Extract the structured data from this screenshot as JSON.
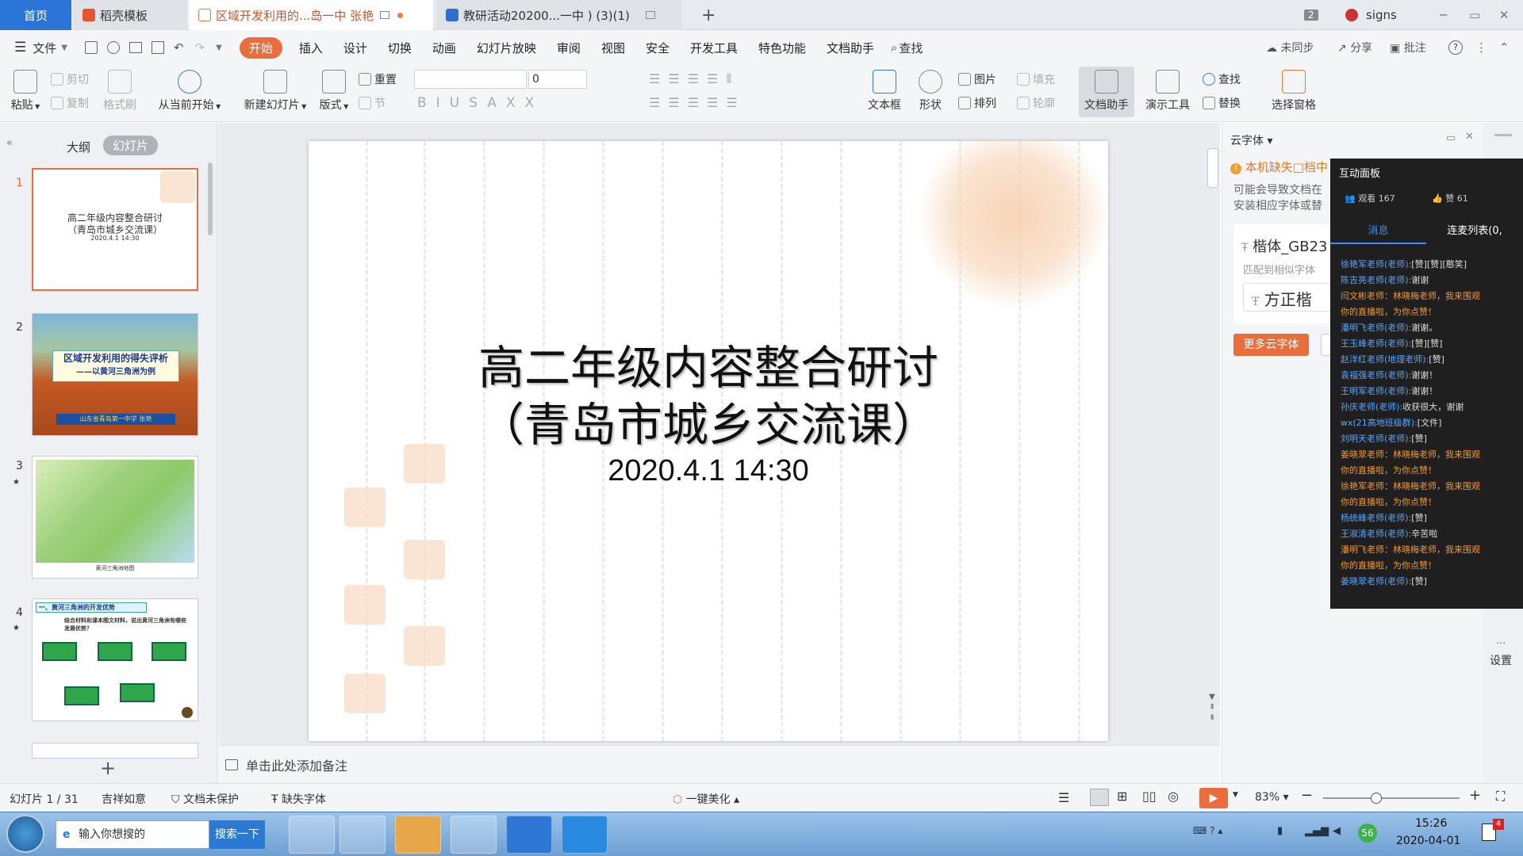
{
  "tabs": {
    "home": "首页",
    "templates": "稻壳模板",
    "doc1": "区域开发利用的...岛一中 张艳",
    "doc2": "教研活动20200...一中 ) (3)(1)",
    "add": "+",
    "badge": "2",
    "user": "signs"
  },
  "menu": {
    "file": "文件",
    "items": [
      "开始",
      "插入",
      "设计",
      "切换",
      "动画",
      "幻灯片放映",
      "审阅",
      "视图",
      "安全",
      "开发工具",
      "特色功能",
      "文档助手"
    ],
    "search": "查找",
    "sync": "未同步",
    "share": "分享",
    "annotate": "批注"
  },
  "ribbon": {
    "paste": "粘贴",
    "cut": "剪切",
    "copy": "复制",
    "format_painter": "格式刷",
    "from_current": "从当前开始",
    "new_slide": "新建幻灯片",
    "layout": "版式",
    "reset": "重置",
    "section": "节",
    "font_size": "0",
    "textbox": "文本框",
    "shape": "形状",
    "picture": "图片",
    "fill": "填充",
    "arrange": "排列",
    "outline": "轮廓",
    "doc_assistant": "文档助手",
    "present_tools": "演示工具",
    "find": "查找",
    "replace": "替换",
    "select_pane": "选择窗格"
  },
  "left_panel": {
    "outline_tab": "大纲",
    "slides_tab": "幻灯片",
    "thumbs": [
      {
        "num": "1",
        "line1": "高二年级内容整合研讨",
        "line2": "（青岛市城乡交流课）",
        "line3": "2020.4.1   14:30"
      },
      {
        "num": "2",
        "line1": "区域开发利用的得失评析",
        "line2": "——以黄河三角洲为例",
        "line3": "山东省青岛第一中学   张艳"
      },
      {
        "num": "3",
        "caption": "黄河三角洲地图"
      },
      {
        "num": "4",
        "heading": "一、黄河三角洲的开发优势",
        "sub": "结合材料和课本图文材料，说出黄河三角洲有哪些发展优势？"
      }
    ]
  },
  "slide": {
    "title_line1": "高二年级内容整合研讨",
    "title_line2": "（青岛市城乡交流课）",
    "date": "2020.4.1   14:30"
  },
  "notes": {
    "placeholder": "单击此处添加备注"
  },
  "right_panel": {
    "title": "云字体",
    "warning": "本机缺失□档中",
    "desc_line1": "可能会导致文档在",
    "desc_line2": "安装相应字体或替",
    "font_name": "楷体_GB23",
    "match_label": "匹配到相似字体",
    "font_sample": "方正楷",
    "more_btn": "更多云字体",
    "settings": "设置"
  },
  "live": {
    "title": "互动面板",
    "viewers": "观看 167",
    "likes": "赞 61",
    "tab_messages": "消息",
    "tab_mic": "连麦列表(0,",
    "messages": [
      {
        "user": "徐艳军老师(老师):",
        "text": "[赞][赞][憨笑]",
        "type": "u"
      },
      {
        "user": "陈吉亮老师(老师):",
        "text": "谢谢",
        "type": "u"
      },
      {
        "user": "",
        "text": "闫文彬老师：林晓梅老师，我来围观",
        "type": "o"
      },
      {
        "user": "",
        "text": "你的直播啦，为你点赞！",
        "type": "o"
      },
      {
        "user": "潘明飞老师(老师):",
        "text": "谢谢。",
        "type": "u"
      },
      {
        "user": "王玉峰老师(老师):",
        "text": "[赞][赞]",
        "type": "u"
      },
      {
        "user": "赵洋红老师(地理老师):",
        "text": "[赞]",
        "type": "u"
      },
      {
        "user": "袁福强老师(老师):",
        "text": "谢谢！",
        "type": "u"
      },
      {
        "user": "王明军老师(老师):",
        "text": "谢谢！",
        "type": "u"
      },
      {
        "user": "孙庆老师(老师):",
        "text": "收获很大，谢谢",
        "type": "u"
      },
      {
        "user": "wx(21高地班级群):",
        "text": "[文件]",
        "type": "u"
      },
      {
        "user": "刘明天老师(老师):",
        "text": "[赞]",
        "type": "u"
      },
      {
        "user": "",
        "text": "姜晓翠老师：林晓梅老师，我来围观",
        "type": "o"
      },
      {
        "user": "",
        "text": "你的直播啦，为你点赞！",
        "type": "o"
      },
      {
        "user": "",
        "text": "徐艳军老师：林晓梅老师，我来围观",
        "type": "o"
      },
      {
        "user": "",
        "text": "你的直播啦，为你点赞！",
        "type": "o"
      },
      {
        "user": "杨统峰老师(老师):",
        "text": "[赞]",
        "type": "u"
      },
      {
        "user": "王淑清老师(老师):",
        "text": "辛苦啦",
        "type": "u"
      },
      {
        "user": "",
        "text": "潘明飞老师：林晓梅老师，我来围观",
        "type": "o"
      },
      {
        "user": "",
        "text": "你的直播啦，为你点赞！",
        "type": "o"
      },
      {
        "user": "姜晓翠老师(老师):",
        "text": "[赞]",
        "type": "u"
      }
    ]
  },
  "status": {
    "slide_count": "幻灯片 1 / 31",
    "theme": "吉祥如意",
    "protection": "文档未保护",
    "missing_font": "缺失字体",
    "beautify": "一键美化",
    "zoom": "83%"
  },
  "taskbar": {
    "search_placeholder": "输入你想搜的",
    "search_btn": "搜索一下",
    "tray_badge": "56",
    "time": "15:26",
    "date": "2020-04-01",
    "notif": "4"
  },
  "colors": {
    "accent": "#ea6e3c",
    "live_user": "#5aa7ff",
    "live_orange": "#f29a2e"
  }
}
